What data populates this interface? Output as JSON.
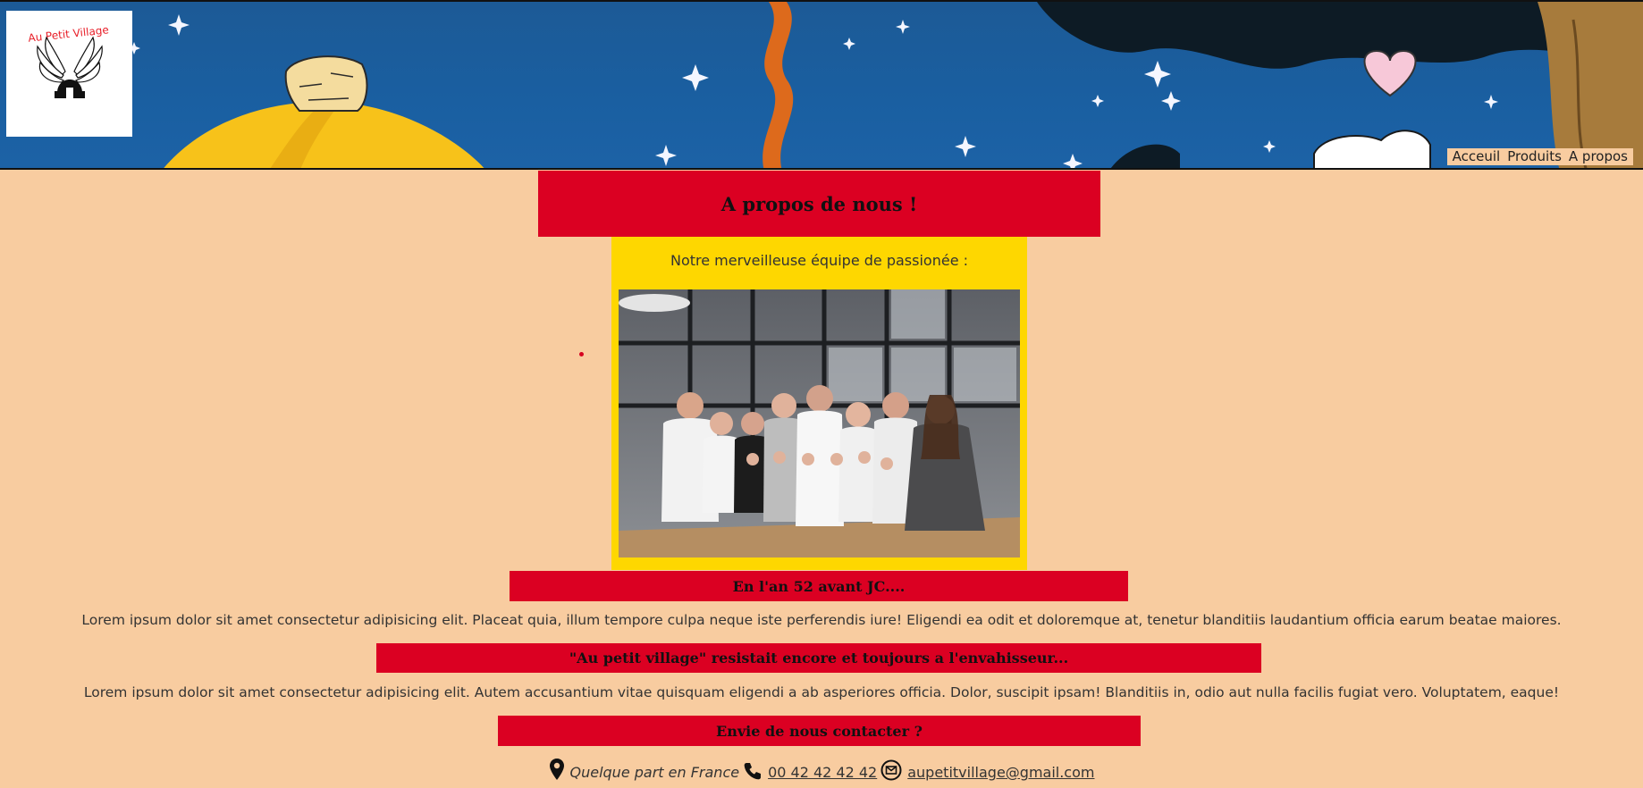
{
  "logo": {
    "text": "Au Petit Village"
  },
  "nav": {
    "items": [
      "Acceuil",
      "Produits",
      "A propos"
    ]
  },
  "page": {
    "title": "A propos de nous !"
  },
  "team": {
    "caption": "Notre merveilleuse équipe de passionée :"
  },
  "sections": [
    {
      "heading": "En l'an 52 avant JC....",
      "text": "Lorem ipsum dolor sit amet consectetur adipisicing elit. Placeat quia, illum tempore culpa neque iste perferendis iure! Eligendi ea odit et doloremque at, tenetur blanditiis laudantium officia earum beatae maiores."
    },
    {
      "heading": "\"Au petit village\" resistait encore et toujours a l'envahisseur...",
      "text": "Lorem ipsum dolor sit amet consectetur adipisicing elit. Autem accusantium vitae quisquam eligendi a ab asperiores officia. Dolor, suscipit ipsam! Blanditiis in, odio aut nulla facilis fugiat vero. Voluptatem, eaque!"
    },
    {
      "heading": "Envie de nous contacter ?"
    }
  ],
  "contact": {
    "address": "Quelque part en France",
    "phone": "00 42 42 42 42",
    "email": "aupetitvillage@gmail.com"
  },
  "colors": {
    "background": "#f8cca0",
    "heading_bar": "#db0022",
    "team_card": "#fed700",
    "banner_sky": "#1a5fa1"
  }
}
